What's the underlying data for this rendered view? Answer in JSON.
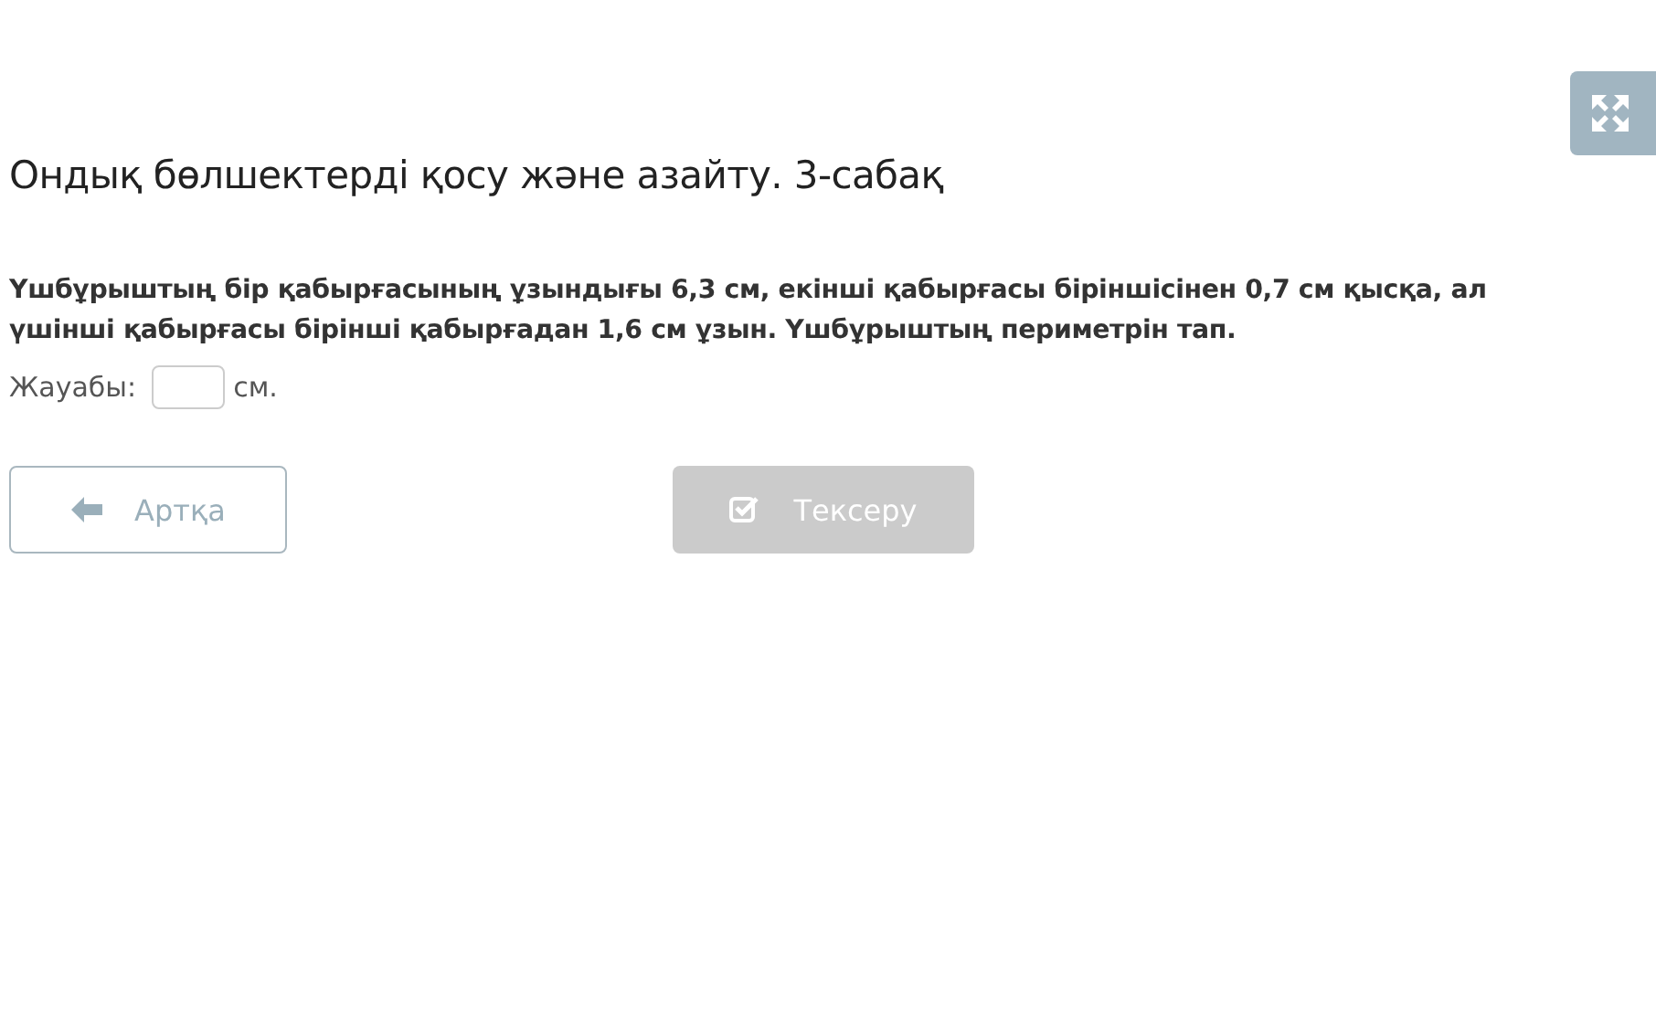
{
  "title": "Ондық бөлшектерді қосу және азайту. 3-сабақ",
  "question": "Үшбұрыштың бір қабырғасының ұзындығы 6,3 см, екінші қабырғасы біріншісінен 0,7 см қысқа, ал үшінші қабырғасы бірінші қабырғадан 1,6 см ұзын. Үшбұрыштың периметрін тап.",
  "answer": {
    "label": "Жауабы:",
    "unit": "см."
  },
  "buttons": [
    {
      "kind": "back",
      "label": "Артқа",
      "disabled": false
    },
    {
      "kind": "check",
      "label": "Тексеру",
      "disabled": true
    }
  ]
}
